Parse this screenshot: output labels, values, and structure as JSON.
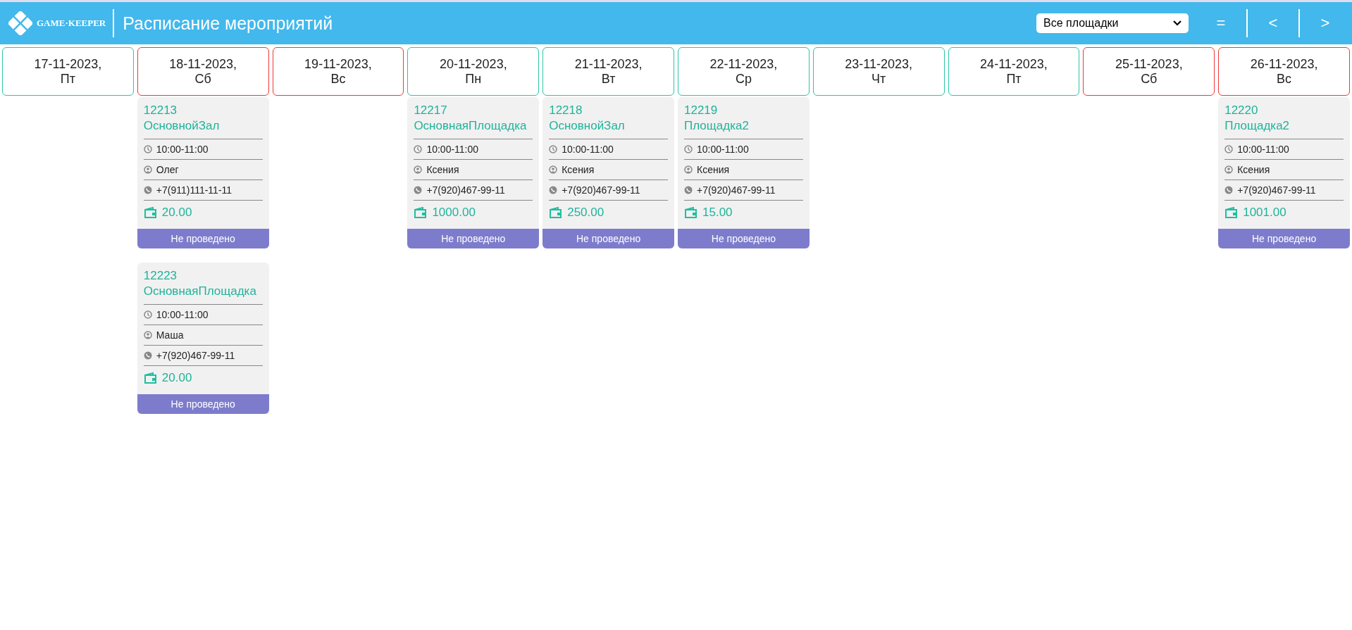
{
  "header": {
    "logo_text": "GAME·KEEPER",
    "title": "Расписание мероприятий",
    "venue_select": {
      "value": "Все площадки"
    },
    "buttons": [
      "=",
      "<",
      ">"
    ]
  },
  "days": [
    {
      "date": "17-11-2023,",
      "weekday": "Пт",
      "weekend": false
    },
    {
      "date": "18-11-2023,",
      "weekday": "Сб",
      "weekend": true,
      "events": [
        {
          "id": "12213",
          "venue": "ОсновнойЗал",
          "time": "10:00-11:00",
          "person": "Олег",
          "phone": "+7(911)111-11-11",
          "amount": "20.00",
          "status": "Не проведено"
        },
        {
          "id": "12223",
          "venue": "ОсновнаяПлощадка",
          "time": "10:00-11:00",
          "person": "Маша",
          "phone": "+7(920)467-99-11",
          "amount": "20.00",
          "status": "Не проведено"
        }
      ]
    },
    {
      "date": "19-11-2023,",
      "weekday": "Вс",
      "weekend": true
    },
    {
      "date": "20-11-2023,",
      "weekday": "Пн",
      "weekend": false,
      "events": [
        {
          "id": "12217",
          "venue": "ОсновнаяПлощадка",
          "time": "10:00-11:00",
          "person": "Ксения",
          "phone": "+7(920)467-99-11",
          "amount": "1000.00",
          "status": "Не проведено"
        }
      ]
    },
    {
      "date": "21-11-2023,",
      "weekday": "Вт",
      "weekend": false,
      "events": [
        {
          "id": "12218",
          "venue": "ОсновнойЗал",
          "time": "10:00-11:00",
          "person": "Ксения",
          "phone": "+7(920)467-99-11",
          "amount": "250.00",
          "status": "Не проведено"
        }
      ]
    },
    {
      "date": "22-11-2023,",
      "weekday": "Ср",
      "weekend": false,
      "events": [
        {
          "id": "12219",
          "venue": "Площадка2",
          "time": "10:00-11:00",
          "person": "Ксения",
          "phone": "+7(920)467-99-11",
          "amount": "15.00",
          "status": "Не проведено"
        }
      ]
    },
    {
      "date": "23-11-2023,",
      "weekday": "Чт",
      "weekend": false
    },
    {
      "date": "24-11-2023,",
      "weekday": "Пт",
      "weekend": false
    },
    {
      "date": "25-11-2023,",
      "weekday": "Сб",
      "weekend": true
    },
    {
      "date": "26-11-2023,",
      "weekday": "Вс",
      "weekend": true,
      "events": [
        {
          "id": "12220",
          "venue": "Площадка2",
          "time": "10:00-11:00",
          "person": "Ксения",
          "phone": "+7(920)467-99-11",
          "amount": "1001.00",
          "status": "Не проведено"
        }
      ]
    }
  ]
}
